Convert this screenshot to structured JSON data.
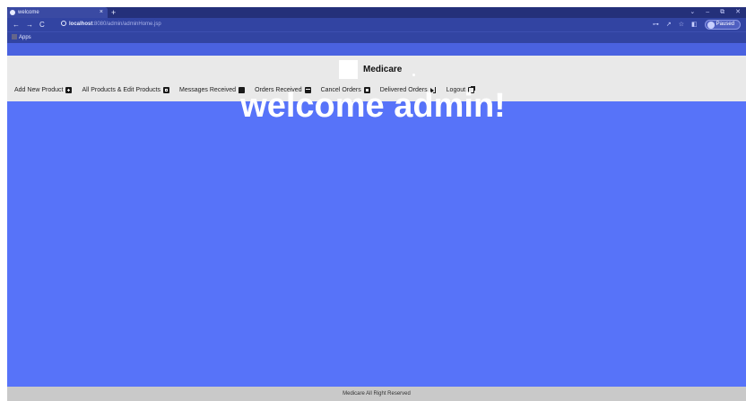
{
  "browser": {
    "tab_title": "welcome",
    "tab_close": "×",
    "new_tab": "+",
    "window_controls": [
      "⌄",
      "–",
      "⧉",
      "✕"
    ],
    "nav_buttons": [
      "←",
      "→",
      "C"
    ],
    "url_host": "localhost",
    "url_path": ":8080/admin/adminHome.jsp",
    "right_icons": [
      "⊶",
      "↗",
      "☆",
      "◧"
    ],
    "profile_label": "Paused",
    "bookmarks_apps": "Apps"
  },
  "site": {
    "brand": "Medicare",
    "nav": [
      {
        "label": "Add New Product",
        "icon": "plus-square-icon"
      },
      {
        "label": "All Products & Edit Products",
        "icon": "edit-square-icon"
      },
      {
        "label": "Messages Received",
        "icon": "message-icon"
      },
      {
        "label": "Orders Received",
        "icon": "archive-box-icon"
      },
      {
        "label": "Cancel Orders",
        "icon": "close-square-icon"
      },
      {
        "label": "Delivered Orders",
        "icon": "truck-icon"
      },
      {
        "label": "Logout",
        "icon": "external-link-icon"
      }
    ],
    "welcome": "welcome admin!",
    "footer": "Medicare All Right Reserved"
  },
  "colors": {
    "page_background": "#5773f9",
    "header_background": "#e9e9e9",
    "footer_background": "#c9c9c9",
    "browser_chrome": "#3244a2"
  }
}
